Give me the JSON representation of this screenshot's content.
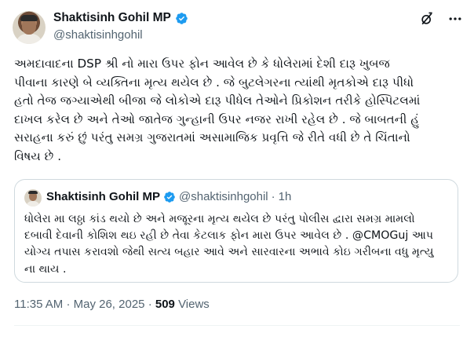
{
  "author": {
    "display_name": "Shaktisinh Gohil MP",
    "handle": "@shaktisinhgohil"
  },
  "icons": {
    "verified": "verified-badge-icon",
    "grok": "grok-icon",
    "more": "more-options-icon"
  },
  "colors": {
    "verified": "#1d9bf0",
    "text_primary": "#0f1419",
    "text_secondary": "#536471",
    "border": "#cfd9de"
  },
  "tweet": {
    "text": "અમદાવાદના DSP શ્રી નો મારા ઉપર ફોન આવેલ છે કે ધોલેરામાં દેશી દારૂ ખુબજ\nપીવાના કારણે બે વ્યક્તિના મૃત્ય થયેલ છે . જે બુટલેગરના ત્યાંથી મૃતકોએ દારૂ પીધો\nહતો તેજ જગ્યાએથી બીજા જે લોકોએ દારૂ પીધેલ તેઓને પ્રિકોશન તરીકે હોસ્પિટલમાં\nદાખલ કરેલ છે અને તેઓ જાતેજ ગુન્હાની ઉપર નજર રાખી રહેલ છે . જે બાબતની હું\nસરાહના કરું છું પરંતુ સમગ્ર ગુજરાતમાં અસામાજિક પ્રવૃત્તિ જે રીતે વધી છે તે ચિંતાનો\nવિષય છે .",
    "time": "11:35 AM",
    "separator": "·",
    "date": "May 26, 2025",
    "views_count": "509",
    "views_label": "Views"
  },
  "quoted": {
    "display_name": "Shaktisinh Gohil MP",
    "handle": "@shaktisinhgohil",
    "separator": "·",
    "age": "1h",
    "text": "ધોલેરા મા લઠ્ઠા કાંડ થયો છે અને મજૂરના મૃત્ય થયેલ છે પરંતુ પોલીસ દ્વારા સમગ્ર મામલો\nદબાવી દેવાની કોશિશ થઇ રહી છે તેવા કેટલાક ફોન મારા ઉપર આવેલ છે . @CMOGuj આપ\nયોગ્ય તપાસ કરાવશો જેથી સત્ય બહાર આવે અને સારવારના અભાવે કોઇ ગરીબના વધુ મૃત્યુ\nના થાય ."
  }
}
